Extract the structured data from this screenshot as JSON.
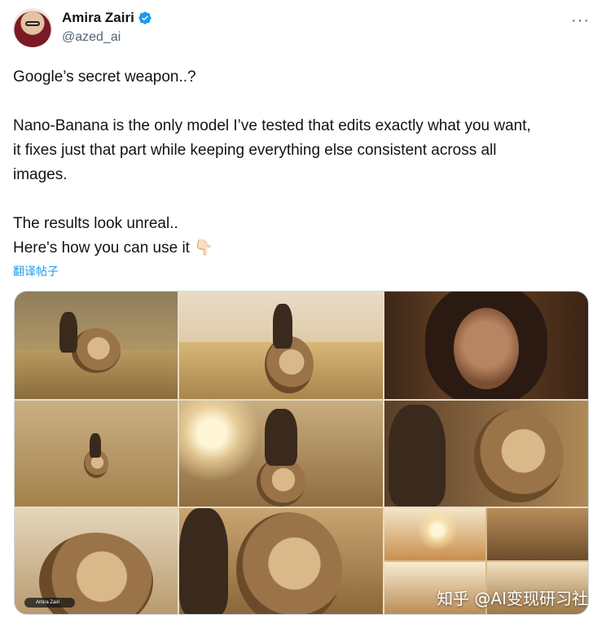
{
  "author": {
    "display_name": "Amira Zairi",
    "handle": "@azed_ai"
  },
  "tweet": {
    "line1": "Google’s secret weapon..?",
    "line2": "Nano-Banana is the only model I’ve tested that edits exactly what you want,\nit fixes just that part while keeping everything else consistent across all\nimages.",
    "line3": "The results look unreal..\nHere's how you can use it 👇🏻",
    "translate_label": "翻译帖子"
  },
  "media": {
    "watermark": "知乎 @AI变现研习社",
    "signature": "Amira Zairi"
  },
  "icons": {
    "verified": "verified-badge-icon",
    "more": "more-options-icon"
  },
  "colors": {
    "accent": "#1d9bf0",
    "text": "#0f1419",
    "muted": "#536471"
  }
}
